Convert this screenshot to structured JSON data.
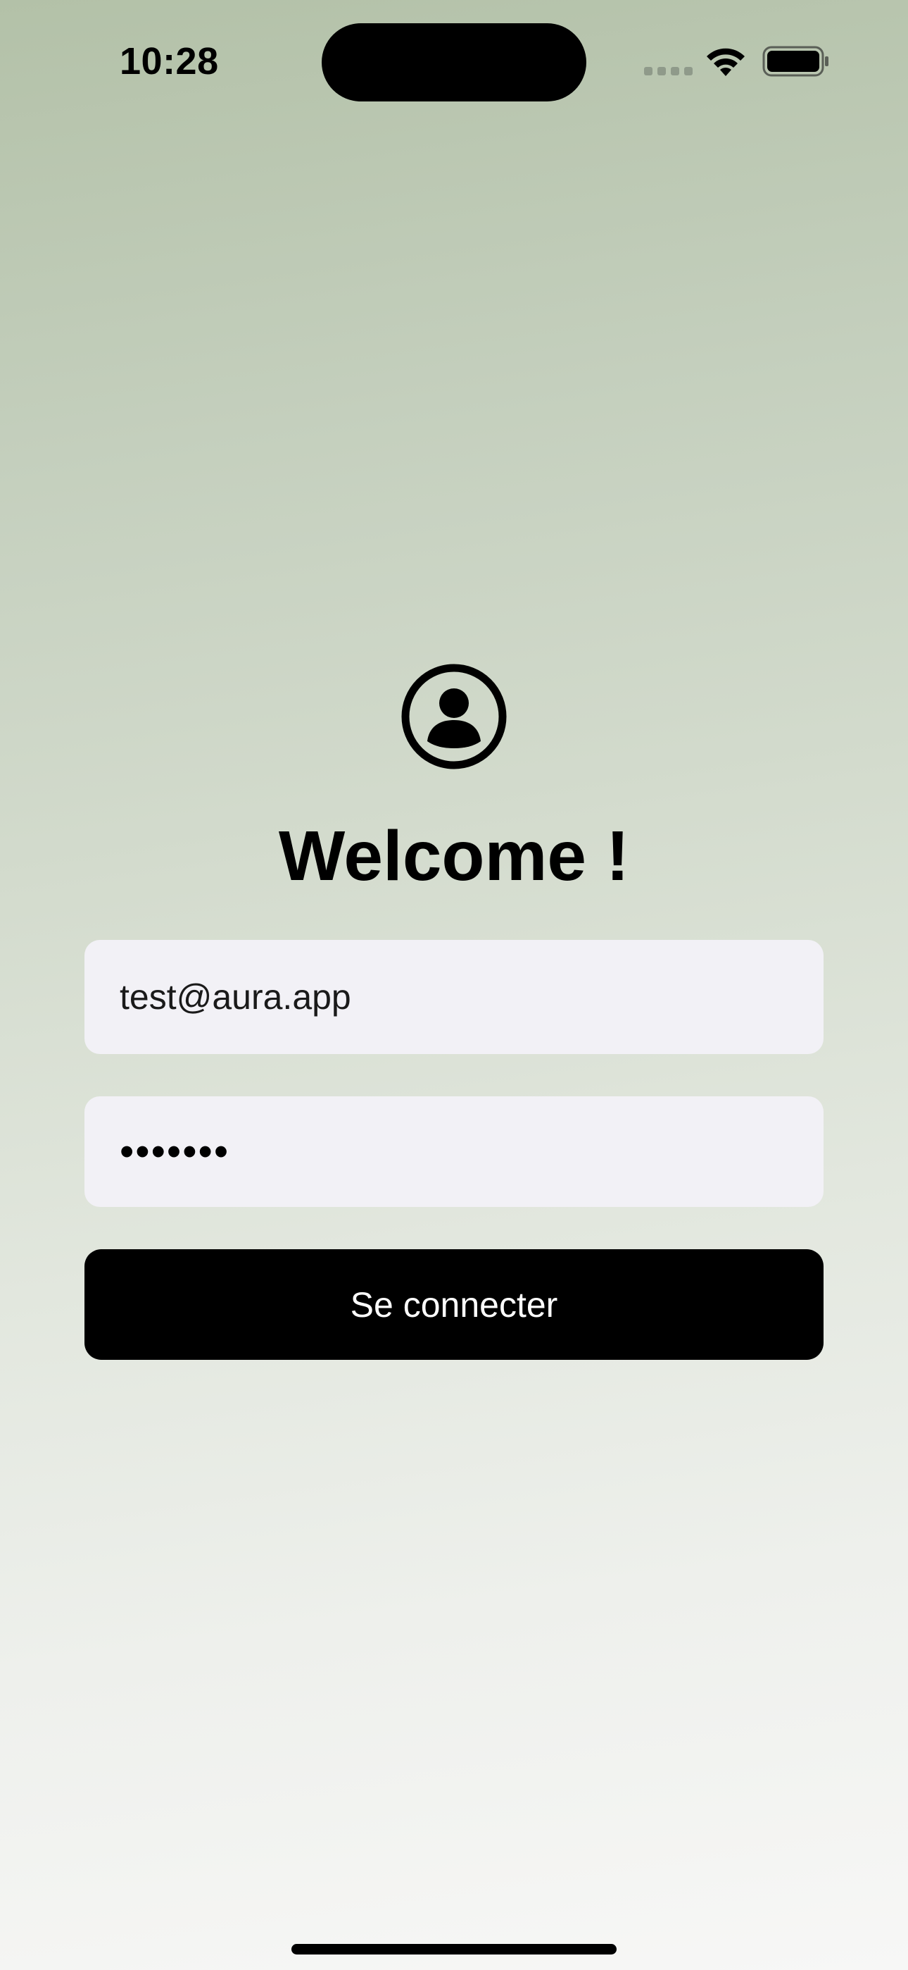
{
  "status_bar": {
    "time": "10:28"
  },
  "login": {
    "avatar_icon": "person-crop-circle-icon",
    "title": "Welcome !",
    "email_value": "test@aura.app",
    "password_mask": "•••••••",
    "submit_label": "Se connecter"
  },
  "colors": {
    "gradient_top": "#b3c1a8",
    "gradient_bottom": "#f7f7f6",
    "field_background": "#f2f1f6",
    "button_background": "#000000",
    "button_text": "#ffffff"
  }
}
